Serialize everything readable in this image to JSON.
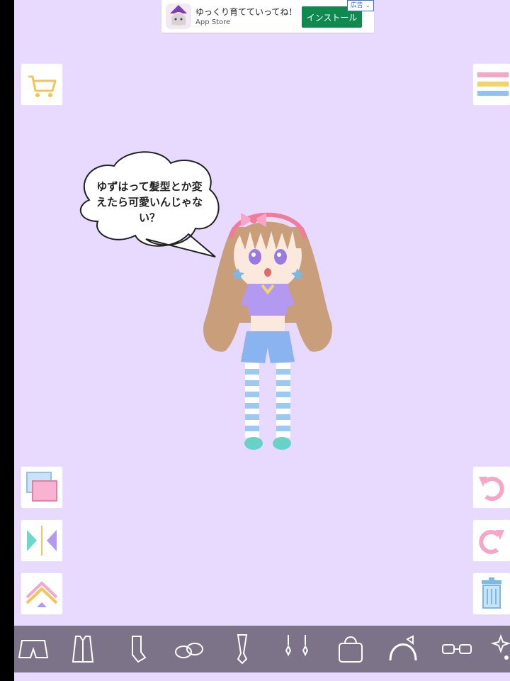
{
  "ad": {
    "title": "ゆっくり育てていってね！",
    "store": "App Store",
    "install_label": "インストール",
    "badge": "広告"
  },
  "speech_bubble": {
    "text": "ゆずはって髪型とか変えたら可愛いんじゃない？"
  },
  "icons": {
    "cart": "cart-icon",
    "menu": "menu-icon",
    "layers": "layers-icon",
    "flip": "flip-icon",
    "bring_front": "bring-front-icon",
    "undo": "undo-icon",
    "redo": "redo-icon",
    "trash": "trash-icon"
  },
  "toolbar": {
    "items": [
      "shorts-icon",
      "outfit-icon",
      "socks-icon",
      "shoes-icon",
      "tie-icon",
      "earrings-icon",
      "bag-icon",
      "headband-icon",
      "glasses-icon",
      "sparkle-icon"
    ]
  },
  "colors": {
    "background": "#e7d9ff",
    "toolbar": "#7d7388",
    "install": "#0f8a4f"
  }
}
